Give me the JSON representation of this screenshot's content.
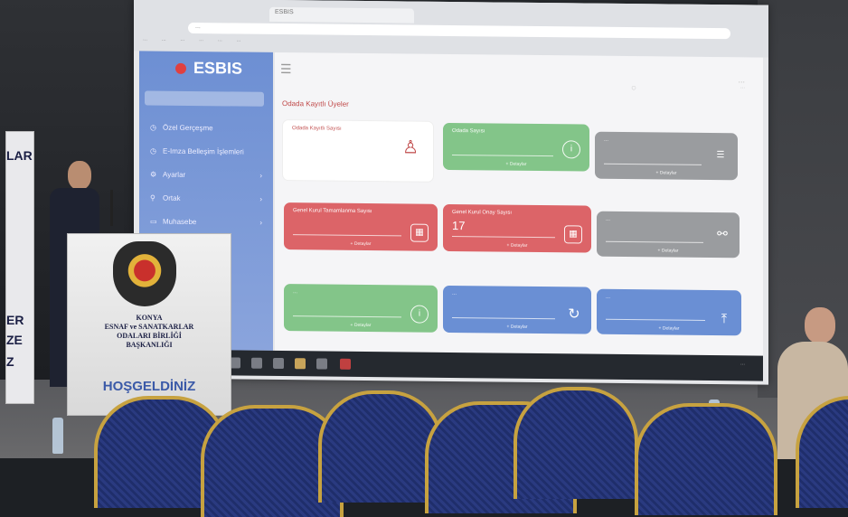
{
  "banner_left": {
    "letters": [
      "LAR",
      "ER",
      "ZE",
      "Z"
    ]
  },
  "browser": {
    "tab": "ESBIS",
    "address": "...",
    "bookmarks": [
      "...",
      "...",
      "...",
      "...",
      "...",
      "..."
    ]
  },
  "app": {
    "logo": "ESBIS",
    "search_placeholder": "",
    "sidebar_items": [
      {
        "label": "Özel Gerçeşme",
        "icon": "clock-icon"
      },
      {
        "label": "E-Imza Belleşim İşlemleri",
        "icon": "clock-icon"
      },
      {
        "label": "Ayarlar",
        "icon": "gear-icon"
      },
      {
        "label": "Ortak",
        "icon": "user-icon"
      },
      {
        "label": "Muhasebe",
        "icon": "file-icon"
      }
    ],
    "page_title": "Odada Kayıtlı Üyeler",
    "user_name": "...",
    "user_sub": "...",
    "cards": [
      {
        "title": "Odada Kayıtlı Sayısı",
        "value": "",
        "color": "white"
      },
      {
        "title": "Odada Sayısı",
        "value": "",
        "color": "green",
        "more": "+ Detaylar"
      },
      {
        "title": "...",
        "value": "",
        "color": "gray",
        "more": "+ Detaylar"
      },
      {
        "title": "Genel Kurul Tamamlanma Sayısı",
        "value": "",
        "color": "red",
        "more": "+ Detaylar"
      },
      {
        "title": "Genel Kurul Onay Sayısı",
        "value": "17",
        "color": "red",
        "more": "+ Detaylar"
      },
      {
        "title": "...",
        "value": "",
        "color": "gray",
        "more": "+ Detaylar"
      },
      {
        "title": "...",
        "value": "",
        "color": "green",
        "more": "+ Detaylar"
      },
      {
        "title": "...",
        "value": "",
        "color": "blue",
        "more": "+ Detaylar"
      },
      {
        "title": "...",
        "value": "",
        "color": "blue",
        "more": "+ Detaylar"
      }
    ]
  },
  "taskbar": {
    "clock": "..."
  },
  "podium": {
    "org_lines": [
      "KONYA",
      "ESNAF ve SANATKARLAR",
      "ODALARI BİRLİĞİ",
      "BAŞKANLIĞI"
    ],
    "welcome": "HOŞGELDİNİZ"
  },
  "colors": {
    "sidebar": "#6d8fd3",
    "green": "#83c589",
    "red": "#dc6468",
    "blue": "#6a8fd4",
    "gray": "#9a9c9f",
    "chair_gold": "#c7a240"
  }
}
